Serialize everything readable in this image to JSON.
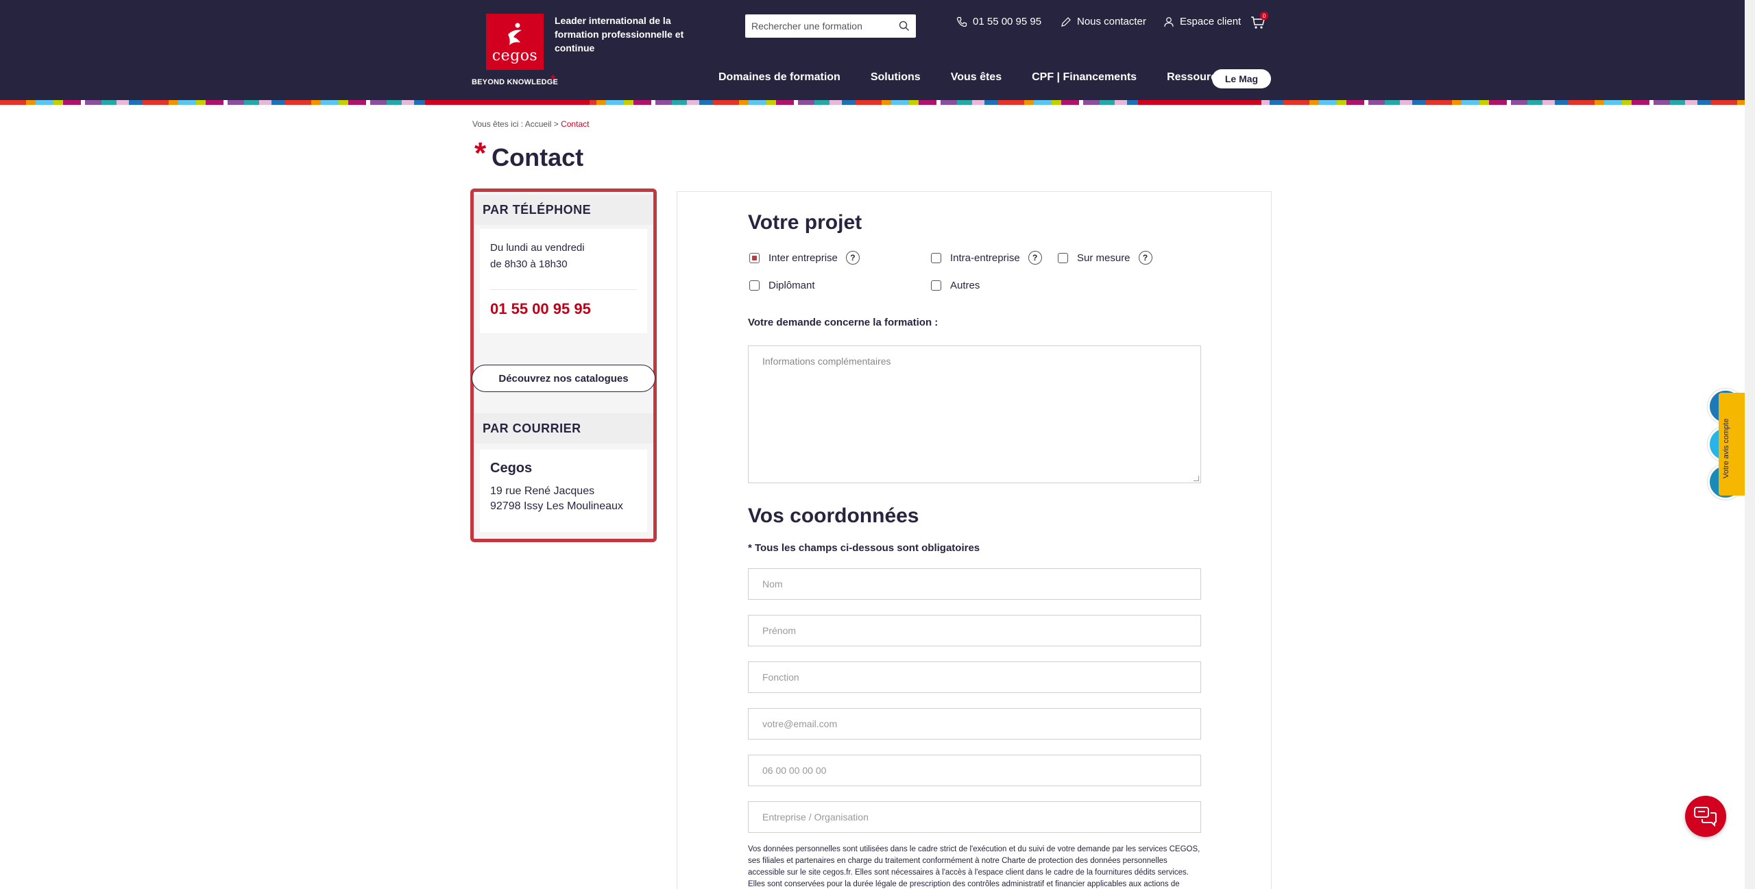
{
  "header": {
    "logo_text": "cegos",
    "logo_tagline": "BEYOND KNOWLEDGE",
    "tagline": "Leader international de la formation professionnelle et continue",
    "search_placeholder": "Rechercher une formation",
    "phone": "01 55 00 95 95",
    "contact_label": "Nous contacter",
    "account_label": "Espace client",
    "cart_count": "0",
    "nav": [
      "Domaines de formation",
      "Solutions",
      "Vous êtes",
      "CPF | Financements",
      "Ressources"
    ],
    "mag_label": "Le Mag"
  },
  "breadcrumb": {
    "prefix": "Vous êtes ici : ",
    "home": "Accueil",
    "separator": " > ",
    "current": "Contact"
  },
  "page": {
    "title_star": "*",
    "title": "Contact"
  },
  "sidebar": {
    "phone_heading": "PAR TÉLÉPHONE",
    "hours_line1": "Du lundi au vendredi",
    "hours_line2": "de 8h30 à 18h30",
    "phone_number": "01 55 00 95 95",
    "catalog_button": "Découvrez nos catalogues",
    "mail_heading": "PAR COURRIER",
    "company": "Cegos",
    "address_line1": "19 rue René Jacques",
    "address_line2": "92798 Issy Les Moulineaux"
  },
  "form": {
    "project_title": "Votre projet",
    "options": [
      {
        "label": "Inter entreprise",
        "checked": true,
        "help": "?"
      },
      {
        "label": "Intra-entreprise",
        "checked": false,
        "help": "?"
      },
      {
        "label": "Sur mesure",
        "checked": false,
        "help": "?"
      },
      {
        "label": "Diplômant",
        "checked": false
      },
      {
        "label": "Autres",
        "checked": false
      }
    ],
    "formation_label": "Votre demande concerne la formation :",
    "textarea_placeholder": "Informations complémentaires",
    "coords_title": "Vos coordonnées",
    "required_note": "* Tous les champs ci-dessous sont obligatoires",
    "fields": [
      "Nom",
      "Prénom",
      "Fonction",
      "votre@email.com",
      "06 00 00 00 00",
      "Entreprise / Organisation"
    ],
    "disclaimer": "Vos données personnelles sont utilisées dans le cadre strict de l'exécution et du suivi de votre demande par les services CEGOS, ses filiales et partenaires en charge du traitement conformément à notre Charte de protection des données personnelles accessible sur le site cegos.fr. Elles sont nécessaires à l'accès à l'espace client dans le cadre de la fournitures dédits services. Elles sont conservées pour la durée légale de prescription des contrôles administratif et financier applicables aux actions de formation. En application de"
  },
  "floating": {
    "avis_label": "Votre avis compte"
  },
  "colors": {
    "header_bg": "#27243f",
    "brand_red": "#d2001e",
    "card_border": "#c3373f"
  }
}
